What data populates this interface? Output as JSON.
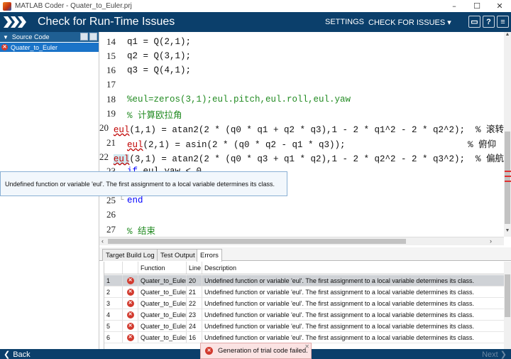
{
  "window": {
    "title": "MATLAB Coder - Quater_to_Euler.prj",
    "minimize": "–",
    "maximize": "☐",
    "close": "✕"
  },
  "header": {
    "title": "Check for Run-Time Issues",
    "settings": "SETTINGS",
    "check_for_issues": "CHECK FOR ISSUES ▾",
    "save_icon": "▭",
    "help_icon": "?",
    "menu_icon": "≡"
  },
  "sidebar": {
    "header": "Source Code",
    "items": [
      {
        "label": "Quater_to_Euler"
      }
    ]
  },
  "editor": {
    "lines": [
      {
        "n": "14",
        "text": "q1 = Q(2,1);"
      },
      {
        "n": "15",
        "text": "q2 = Q(3,1);"
      },
      {
        "n": "16",
        "text": "q3 = Q(4,1);"
      },
      {
        "n": "17",
        "text": ""
      },
      {
        "n": "18",
        "text": "%eul=zeros(3,1);eul.pitch,eul.roll,eul.yaw"
      },
      {
        "n": "19",
        "text": "% 计算欧拉角"
      },
      {
        "n": "20",
        "err": "eul",
        "text": "(1,1) = atan2(2 * (q0 * q1 + q2 * q3),1 - 2 * q1^2 - 2 * q2^2);  % 滚转"
      },
      {
        "n": "21",
        "err": "eul",
        "text": "(2,1) = asin(2 * (q0 * q2 - q1 * q3));                       % 俯仰"
      },
      {
        "n": "22",
        "hl": "eul",
        "text": "(3,1) = atan2(2 * (q0 * q3 + q1 * q2),1 - 2 * q2^2 - 2 * q3^2);  % 偏航"
      },
      {
        "n": "23",
        "text": "eul.yaw < 0"
      },
      {
        "n": "25",
        "text": "end"
      },
      {
        "n": "26",
        "text": ""
      },
      {
        "n": "27",
        "text": "% 结束"
      }
    ]
  },
  "tooltip": {
    "text": "Undefined function or variable 'eul'. The first assignment to a local variable determines its class."
  },
  "tabs": [
    {
      "label": "Target Build Log"
    },
    {
      "label": "Test Output"
    },
    {
      "label": "Errors"
    }
  ],
  "table": {
    "headers": {
      "function": "Function",
      "line": "Line",
      "description": "Description"
    },
    "rows": [
      {
        "idx": "1",
        "fn": "Quater_to_Euler",
        "line": "20",
        "desc": "Undefined function or variable 'eul'. The first assignment to a local variable determines its class."
      },
      {
        "idx": "2",
        "fn": "Quater_to_Euler",
        "line": "21",
        "desc": "Undefined function or variable 'eul'. The first assignment to a local variable determines its class."
      },
      {
        "idx": "3",
        "fn": "Quater_to_Euler",
        "line": "22",
        "desc": "Undefined function or variable 'eul'. The first assignment to a local variable determines its class."
      },
      {
        "idx": "4",
        "fn": "Quater_to_Euler",
        "line": "23",
        "desc": "Undefined function or variable 'eul'. The first assignment to a local variable determines its class."
      },
      {
        "idx": "5",
        "fn": "Quater_to_Euler",
        "line": "24",
        "desc": "Undefined function or variable 'eul'. The first assignment to a local variable determines its class."
      },
      {
        "idx": "6",
        "fn": "Quater_to_Euler",
        "line": "16",
        "desc": "Undefined function or variable 'eul'. The first assignment to a local variable determines its class."
      }
    ]
  },
  "footer": {
    "back": "Back",
    "next": "Next ❯"
  },
  "toast": {
    "text": "Generation of trial code failed.",
    "close": "✕"
  },
  "colors": {
    "header_bg": "#0b3f6b",
    "selection": "#1a73c8",
    "error": "#d23a2e",
    "comment": "#228b22",
    "keyword": "#0000ff"
  }
}
